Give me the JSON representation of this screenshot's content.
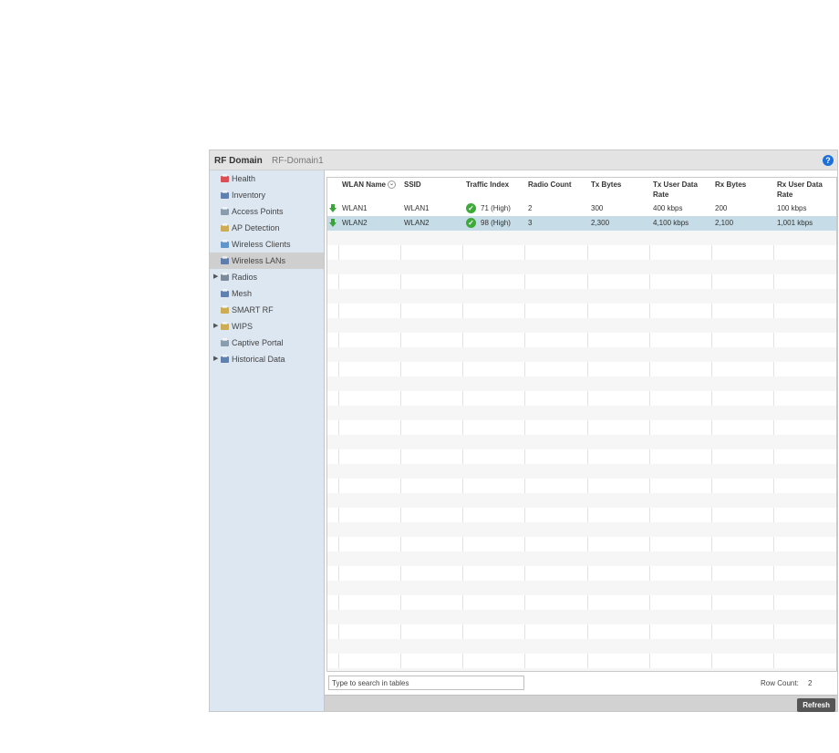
{
  "header": {
    "title": "RF Domain",
    "subtitle": "RF-Domain1",
    "help": "?"
  },
  "sidebar": {
    "items": [
      {
        "label": "Health",
        "icon": "health-icon",
        "arrow": "",
        "selected": false
      },
      {
        "label": "Inventory",
        "icon": "inventory-icon",
        "arrow": "",
        "selected": false
      },
      {
        "label": "Access Points",
        "icon": "access-points-icon",
        "arrow": "",
        "selected": false
      },
      {
        "label": "AP Detection",
        "icon": "ap-detection-icon",
        "arrow": "",
        "selected": false
      },
      {
        "label": "Wireless Clients",
        "icon": "wireless-clients-icon",
        "arrow": "",
        "selected": false
      },
      {
        "label": "Wireless LANs",
        "icon": "wireless-lans-icon",
        "arrow": "",
        "selected": true
      },
      {
        "label": "Radios",
        "icon": "radios-icon",
        "arrow": "▶",
        "selected": false
      },
      {
        "label": "Mesh",
        "icon": "mesh-icon",
        "arrow": "",
        "selected": false
      },
      {
        "label": "SMART RF",
        "icon": "smart-rf-icon",
        "arrow": "",
        "selected": false
      },
      {
        "label": "WIPS",
        "icon": "wips-icon",
        "arrow": "▶",
        "selected": false
      },
      {
        "label": "Captive Portal",
        "icon": "captive-portal-icon",
        "arrow": "",
        "selected": false
      },
      {
        "label": "Historical Data",
        "icon": "historical-data-icon",
        "arrow": "▶",
        "selected": false
      }
    ]
  },
  "table": {
    "columns": [
      "WLAN Name",
      "SSID",
      "Traffic Index",
      "Radio Count",
      "Tx Bytes",
      "Tx User Data Rate",
      "Rx Bytes",
      "Rx User Data Rate"
    ],
    "rows": [
      [
        "WLAN1",
        "WLAN1",
        "71 (High)",
        "2",
        "300",
        "400 kbps",
        "200",
        "100 kbps"
      ],
      [
        "WLAN2",
        "WLAN2",
        "98 (High)",
        "3",
        "2,300",
        "4,100 kbps",
        "2,100",
        "1,001 kbps"
      ]
    ]
  },
  "footer": {
    "search_placeholder": "Type to search in tables",
    "row_count_label": "Row Count:",
    "row_count_value": "2",
    "refresh_label": "Refresh"
  },
  "colors": {
    "sidebar_bg": "#dde7f2",
    "selected_row": "#c6dce6",
    "status_green": "#3aa43a",
    "help_blue": "#1d6fd8"
  }
}
